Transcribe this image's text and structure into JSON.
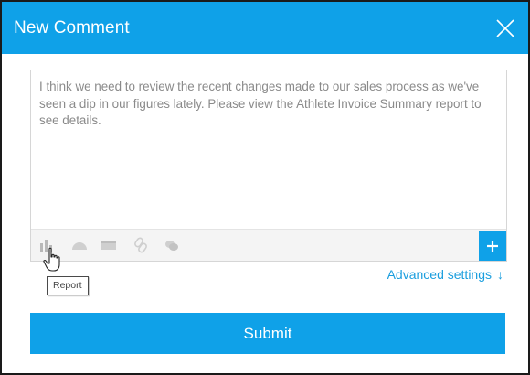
{
  "dialog": {
    "title": "New Comment",
    "close_icon": "close-icon"
  },
  "editor": {
    "text": "I think we need to review the recent changes made to our sales process as we've seen a dip in our figures lately. Please view the Athlete Invoice Summary report to see details.",
    "toolbar": {
      "icons": [
        "report-icon",
        "dashboard-icon",
        "content-icon",
        "link-icon",
        "comments-icon"
      ],
      "add_icon": "plus-icon"
    }
  },
  "tooltip": {
    "label": "Report"
  },
  "advanced": {
    "label": "Advanced settings",
    "arrow": "↓"
  },
  "submit": {
    "label": "Submit"
  },
  "colors": {
    "accent": "#0fa1e8",
    "link": "#1a9ede",
    "toolbar_icon": "#c4c4c4"
  }
}
